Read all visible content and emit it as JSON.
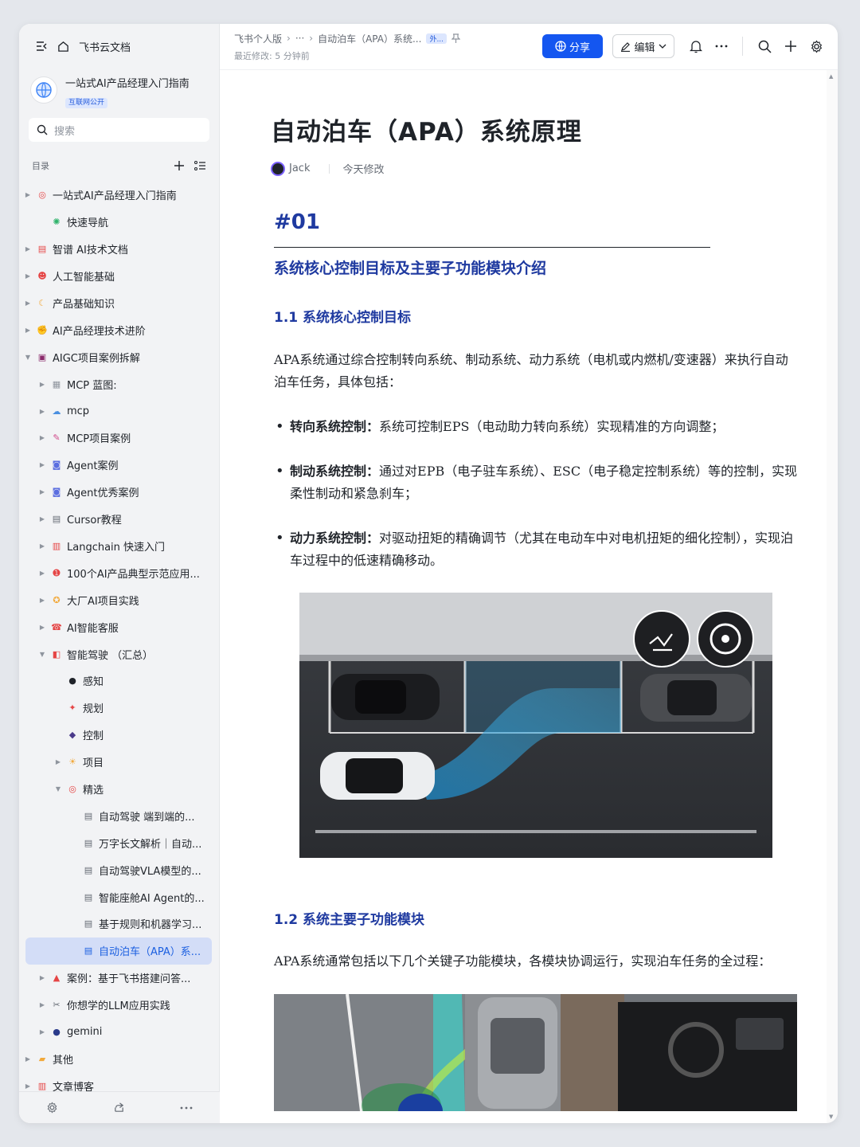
{
  "sidebar": {
    "app_name": "飞书云文档",
    "space_title": "一站式AI产品经理入门指南",
    "space_badge": "互联网公开",
    "search_placeholder": "搜索",
    "toc_label": "目录",
    "items": [
      {
        "label": "一站式AI产品经理入门指南",
        "level": 0,
        "arrow": "right",
        "icon": "target-icon",
        "color": "#e54545"
      },
      {
        "label": "快速导航",
        "level": 1,
        "arrow": "",
        "icon": "compass-icon",
        "color": "#2fb36b"
      },
      {
        "label": "智谱 AI技术文档",
        "level": 0,
        "arrow": "right",
        "icon": "doc-icon",
        "color": "#e54545"
      },
      {
        "label": "人工智能基础",
        "level": 0,
        "arrow": "right",
        "icon": "face-icon",
        "color": "#e54545"
      },
      {
        "label": "产品基础知识",
        "level": 0,
        "arrow": "right",
        "icon": "moon-icon",
        "color": "#f2a93b"
      },
      {
        "label": "AI产品经理技术进阶",
        "level": 0,
        "arrow": "right",
        "icon": "muscle-icon",
        "color": "#f2a93b"
      },
      {
        "label": "AIGC项目案例拆解",
        "level": 0,
        "arrow": "down",
        "icon": "floppy-icon",
        "color": "#8a2a6b"
      },
      {
        "label": "MCP 蓝图:",
        "level": 1,
        "arrow": "right",
        "icon": "grid-icon",
        "color": "#8f959e"
      },
      {
        "label": "mcp",
        "level": 1,
        "arrow": "right",
        "icon": "cloud-icon",
        "color": "#4a8fe0"
      },
      {
        "label": "MCP项目案例",
        "level": 1,
        "arrow": "right",
        "icon": "brush-icon",
        "color": "#d04a8a"
      },
      {
        "label": "Agent案例",
        "level": 1,
        "arrow": "right",
        "icon": "robot-icon",
        "color": "#5b6ee0"
      },
      {
        "label": "Agent优秀案例",
        "level": 1,
        "arrow": "right",
        "icon": "robot-icon",
        "color": "#5b6ee0"
      },
      {
        "label": "Cursor教程",
        "level": 1,
        "arrow": "right",
        "icon": "doc-icon",
        "color": "#646a73"
      },
      {
        "label": "Langchain 快速入门",
        "level": 1,
        "arrow": "right",
        "icon": "page-icon",
        "color": "#e54545"
      },
      {
        "label": "100个AI产品典型示范应用...",
        "level": 1,
        "arrow": "right",
        "icon": "hundred-icon",
        "color": "#e54545"
      },
      {
        "label": "大厂AI项目实践",
        "level": 1,
        "arrow": "right",
        "icon": "medal-icon",
        "color": "#f2a93b"
      },
      {
        "label": "AI智能客服",
        "level": 1,
        "arrow": "right",
        "icon": "phone-icon",
        "color": "#e54545"
      },
      {
        "label": "智能驾驶 （汇总）",
        "level": 1,
        "arrow": "down",
        "icon": "car-icon",
        "color": "#e54545"
      },
      {
        "label": "感知",
        "level": 2,
        "arrow": "",
        "icon": "eyes-icon",
        "color": "#1f2329"
      },
      {
        "label": "规划",
        "level": 2,
        "arrow": "",
        "icon": "pin-icon",
        "color": "#e54545"
      },
      {
        "label": "控制",
        "level": 2,
        "arrow": "",
        "icon": "gamepad-icon",
        "color": "#4a3a8a"
      },
      {
        "label": "项目",
        "level": 2,
        "arrow": "right",
        "icon": "sun-icon",
        "color": "#f2a93b"
      },
      {
        "label": "精选",
        "level": 2,
        "arrow": "down",
        "icon": "target-icon",
        "color": "#e54545"
      },
      {
        "label": "自动驾驶 端到端的...",
        "level": 3,
        "arrow": "",
        "icon": "doc-icon",
        "color": "#646a73"
      },
      {
        "label": "万字长文解析｜自动...",
        "level": 3,
        "arrow": "",
        "icon": "doc-icon",
        "color": "#646a73"
      },
      {
        "label": "自动驾驶VLA模型的...",
        "level": 3,
        "arrow": "",
        "icon": "doc-icon",
        "color": "#646a73"
      },
      {
        "label": "智能座舱AI Agent的...",
        "level": 3,
        "arrow": "",
        "icon": "doc-icon",
        "color": "#646a73"
      },
      {
        "label": "基于规则和机器学习...",
        "level": 3,
        "arrow": "",
        "icon": "doc-icon",
        "color": "#646a73"
      },
      {
        "label": "自动泊车（APA）系...",
        "level": 3,
        "arrow": "",
        "icon": "doc-icon",
        "color": "#1b5fe0",
        "active": true
      },
      {
        "label": "案例：基于飞书搭建问答...",
        "level": 1,
        "arrow": "right",
        "icon": "rocket-icon",
        "color": "#e54545"
      },
      {
        "label": "你想学的LLM应用实践",
        "level": 1,
        "arrow": "right",
        "icon": "tools-icon",
        "color": "#646a73"
      },
      {
        "label": "gemini",
        "level": 1,
        "arrow": "right",
        "icon": "circle-icon",
        "color": "#2a3a8a"
      },
      {
        "label": "其他",
        "level": 0,
        "arrow": "right",
        "icon": "folder-icon",
        "color": "#f2a93b"
      },
      {
        "label": "文章博客",
        "level": 0,
        "arrow": "right",
        "icon": "page-icon",
        "color": "#e54545"
      }
    ]
  },
  "topbar": {
    "crumb1": "飞书个人版",
    "crumb_more": "···",
    "crumb_current": "自动泊车（APA）系统...",
    "crumb_tag": "外...",
    "last_modified": "最近修改: 5 分钟前",
    "share_label": "分享",
    "edit_label": "编辑"
  },
  "doc": {
    "title": "自动泊车（APA）系统原理",
    "author": "Jack",
    "modified": "今天修改",
    "section_no": "#01",
    "section_title": "系统核心控制目标及主要子功能模块介绍",
    "h_1_1": "1.1 系统核心控制目标",
    "p1": "APA系统通过综合控制转向系统、制动系统、动力系统（电机或内燃机/变速器）来执行自动泊车任务，具体包括：",
    "bullets": [
      {
        "bold": "转向系统控制：",
        "text": "系统可控制EPS（电动助力转向系统）实现精准的方向调整；"
      },
      {
        "bold": "制动系统控制：",
        "text": "通过对EPB（电子驻车系统）、ESC（电子稳定控制系统）等的控制，实现柔性制动和紧急刹车；"
      },
      {
        "bold": "动力系统控制：",
        "text": "对驱动扭矩的精确调节（尤其在电动车中对电机扭矩的细化控制），实现泊车过程中的低速精确移动。"
      }
    ],
    "h_1_2": "1.2 系统主要子功能模块",
    "p2": "APA系统通常包括以下几个关键子功能模块，各模块协调运行，实现泊车任务的全过程："
  },
  "colors": {
    "accent": "#1456f0",
    "heading": "#1f3aa0",
    "sidebar_bg": "#f2f3f5",
    "active_bg": "#d3ddf7"
  }
}
